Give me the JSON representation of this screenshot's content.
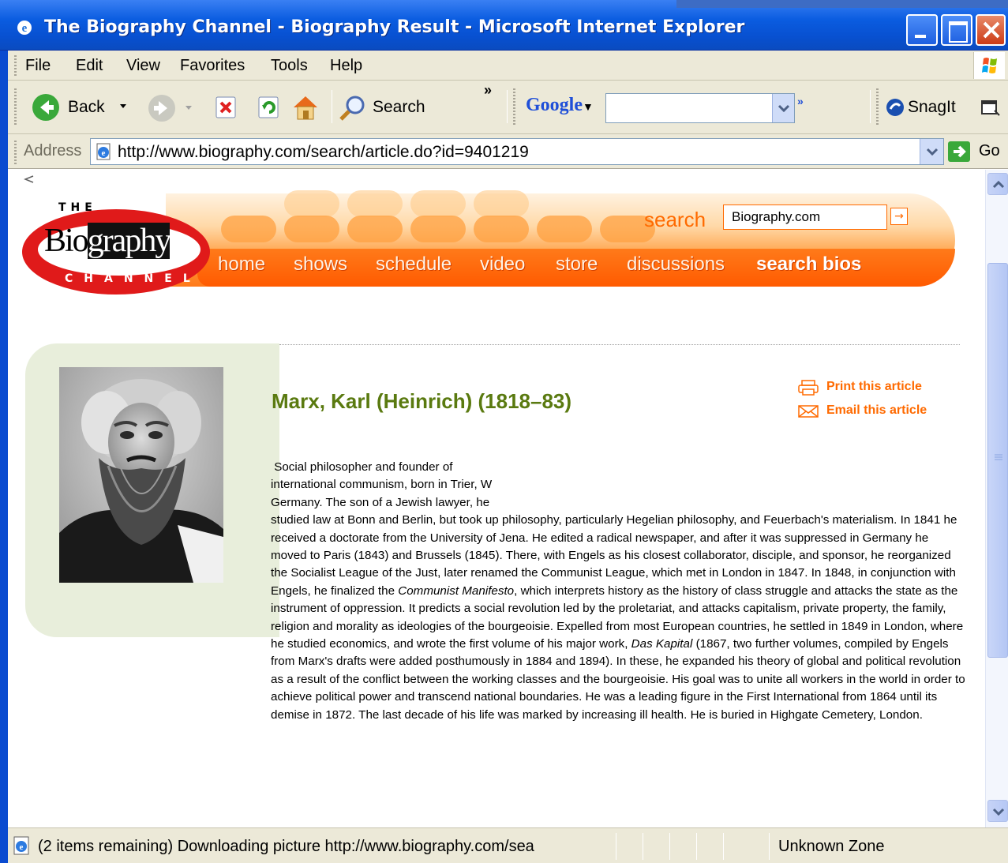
{
  "window": {
    "title": "The Biography Channel - Biography Result - Microsoft Internet Explorer"
  },
  "menu": {
    "items": [
      "File",
      "Edit",
      "View",
      "Favorites",
      "Tools",
      "Help"
    ]
  },
  "toolbar": {
    "back_label": "Back",
    "search_label": "Search",
    "google_label": "Google",
    "snagit_label": "SnagIt",
    "chevron": "»"
  },
  "address": {
    "label": "Address",
    "url": "http://www.biography.com/search/article.do?id=9401219",
    "go_label": "Go"
  },
  "site": {
    "logo_the": "THE",
    "logo_word_a": "Bio",
    "logo_word_b": "graphy",
    "logo_channel": "CHANNEL",
    "search_label": "search",
    "search_value": "Biography.com",
    "nav": [
      "home",
      "shows",
      "schedule",
      "video",
      "store",
      "discussions",
      "search bios"
    ]
  },
  "article": {
    "title": "Marx, Karl (Heinrich) (1818–83)",
    "print_label": "Print this article",
    "email_label": "Email this article",
    "p1": " Social philosopher and founder of",
    "p2": "international communism, born in Trier, W",
    "p3": "Germany. The son of a Jewish lawyer, he",
    "p4_before": "studied law at Bonn and Berlin, but took up philosophy, particularly Hegelian philosophy, and Feuerbach's materialism. In 1841 he received a doctorate from the University of Jena. He edited a radical newspaper, and after it was suppressed in Germany he moved to Paris (1843) and Brussels (1845). There, with Engels as his closest collaborator, disciple, and sponsor, he reorganized the Socialist League of the Just, later renamed the Communist League, which met in London in 1847. In 1848, in conjunction with Engels, he finalized the ",
    "p4_em1": "Communist Manifesto",
    "p4_mid": ", which interprets history as the history of class struggle and attacks the state as the instrument of oppression. It predicts a social revolution led by the proletariat, and attacks capitalism, private property, the family, religion and morality as ideologies of the bourgeoisie. Expelled from most European countries, he settled in 1849 in London, where he studied economics, and wrote the first volume of his major work, ",
    "p4_em2": "Das Kapital",
    "p4_after": " (1867, two further volumes, compiled by Engels from Marx's drafts were added posthumously in 1884 and 1894). In these, he expanded his theory of global and political revolution as a result of the conflict between the working classes and the bourgeoisie. His goal was to unite all workers in the world in order to achieve political power and transcend national boundaries. He was a leading figure in the First International from 1864 until its demise in 1872. The last decade of his life was marked by increasing ill health. He is buried in Highgate Cemetery, London."
  },
  "status": {
    "text": "(2 items remaining) Downloading picture http://www.biography.com/sea",
    "zone": "Unknown Zone"
  },
  "colors": {
    "xp_blue": "#0a5ce0",
    "orange": "#ff6a00",
    "title_green": "#5a7a10",
    "panel_green": "#e8eedb"
  }
}
